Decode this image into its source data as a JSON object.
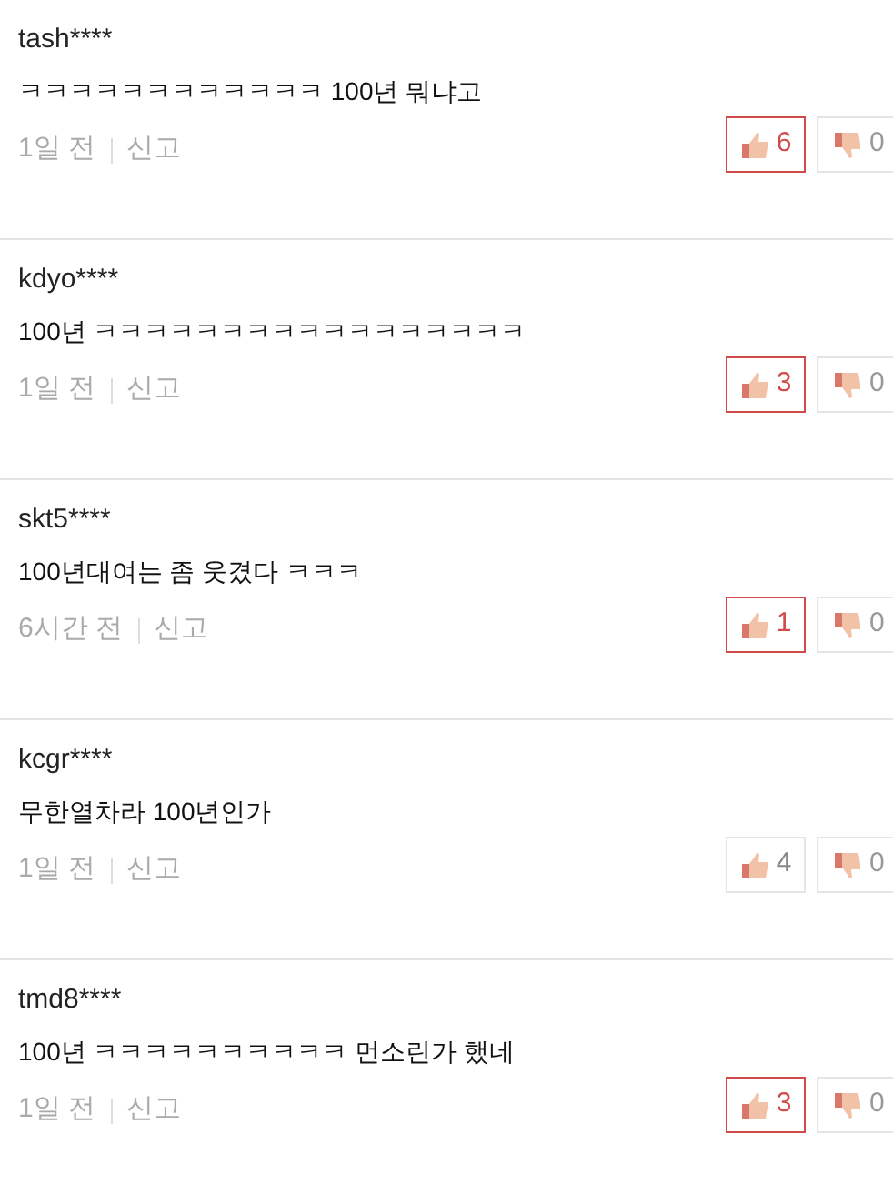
{
  "comments": [
    {
      "user": "tash****",
      "text": "ㅋㅋㅋㅋㅋㅋㅋㅋㅋㅋㅋㅋ 100년 뭐냐고",
      "time": "1일 전",
      "report": "신고",
      "likes": "6",
      "liked": true,
      "dislikes": "0"
    },
    {
      "user": "kdyo****",
      "text": "100년 ㅋㅋㅋㅋㅋㅋㅋㅋㅋㅋㅋㅋㅋㅋㅋㅋㅋ",
      "time": "1일 전",
      "report": "신고",
      "likes": "3",
      "liked": true,
      "dislikes": "0"
    },
    {
      "user": "skt5****",
      "text": "100년대여는 좀 웃겼다 ㅋㅋㅋ",
      "time": "6시간 전",
      "report": "신고",
      "likes": "1",
      "liked": true,
      "dislikes": "0"
    },
    {
      "user": "kcgr****",
      "text": "무한열차라 100년인가",
      "time": "1일 전",
      "report": "신고",
      "likes": "4",
      "liked": false,
      "dislikes": "0"
    },
    {
      "user": "tmd8****",
      "text": "100년 ㅋㅋㅋㅋㅋㅋㅋㅋㅋㅋ 먼소린가 했네",
      "time": "1일 전",
      "report": "신고",
      "likes": "3",
      "liked": true,
      "dislikes": "0"
    }
  ]
}
